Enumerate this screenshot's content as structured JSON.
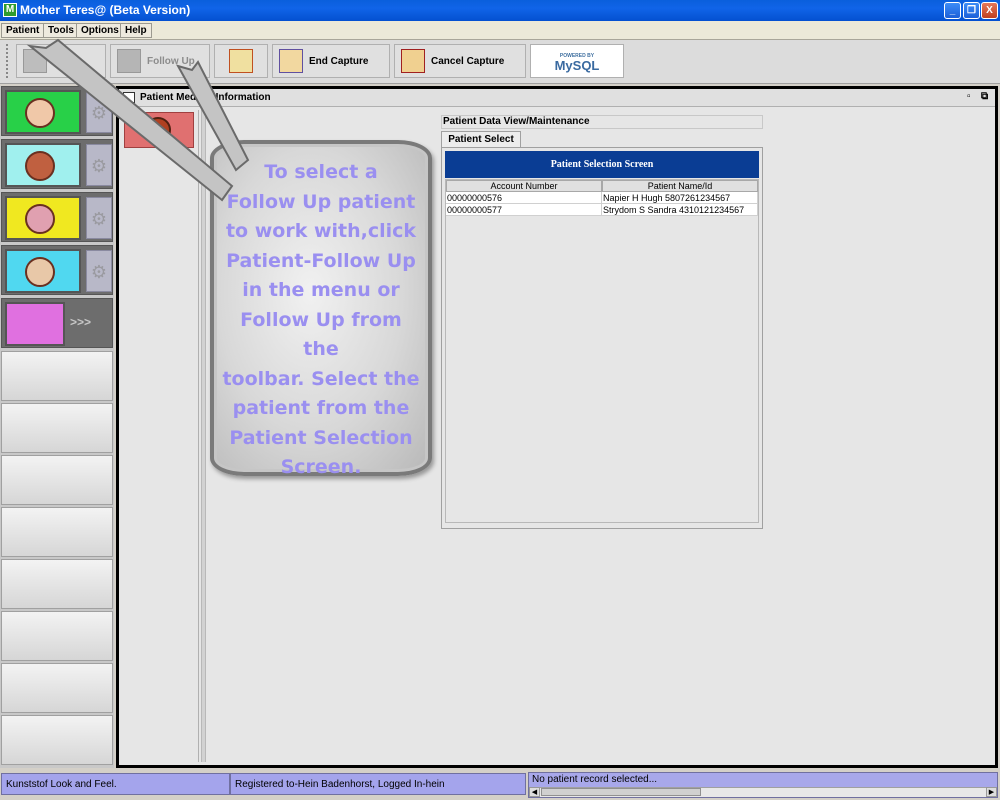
{
  "window": {
    "title": "Mother Teres@ (Beta Version)",
    "app_icon": "M",
    "minimize_glyph": "_",
    "maximize_glyph": "❐",
    "close_glyph": "X"
  },
  "menubar": {
    "items": [
      "Patient",
      "Tools",
      "Options",
      "Help"
    ]
  },
  "toolbar": {
    "new_label": "New",
    "follow_up_label": "Follow Up",
    "end_capture_label": "End Capture",
    "cancel_capture_label": "Cancel Capture",
    "mysql_top": "POWERED BY",
    "mysql_label": "MySQL"
  },
  "sidebar": {
    "more_label": ">>>"
  },
  "internal_frame": {
    "title": "Patient Medical Information",
    "minimize_glyph": "▫",
    "restore_glyph": "⧉"
  },
  "patient_view": {
    "header": "Patient Data View/Maintenance",
    "tab_label": "Patient Select",
    "panel_title": "Patient Selection Screen",
    "columns": [
      "Account Number",
      "Patient Name/Id"
    ],
    "rows": [
      {
        "account": "00000000576",
        "name": "Napier H Hugh 5807261234567"
      },
      {
        "account": "00000000577",
        "name": "Strydom S Sandra 4310121234567"
      }
    ]
  },
  "callout": {
    "lines": [
      "To select a",
      "Follow Up patient",
      "to work with,click",
      "Patient-Follow Up",
      "in the menu or",
      "Follow Up from the",
      "toolbar. Select the",
      "patient from the",
      "Patient Selection",
      "Screen."
    ]
  },
  "statusbar": {
    "look_and_feel": "Kunststof Look and Feel.",
    "registered": "Registered to-Hein Badenhorst, Logged In-hein",
    "record_status": "No patient record selected..."
  }
}
